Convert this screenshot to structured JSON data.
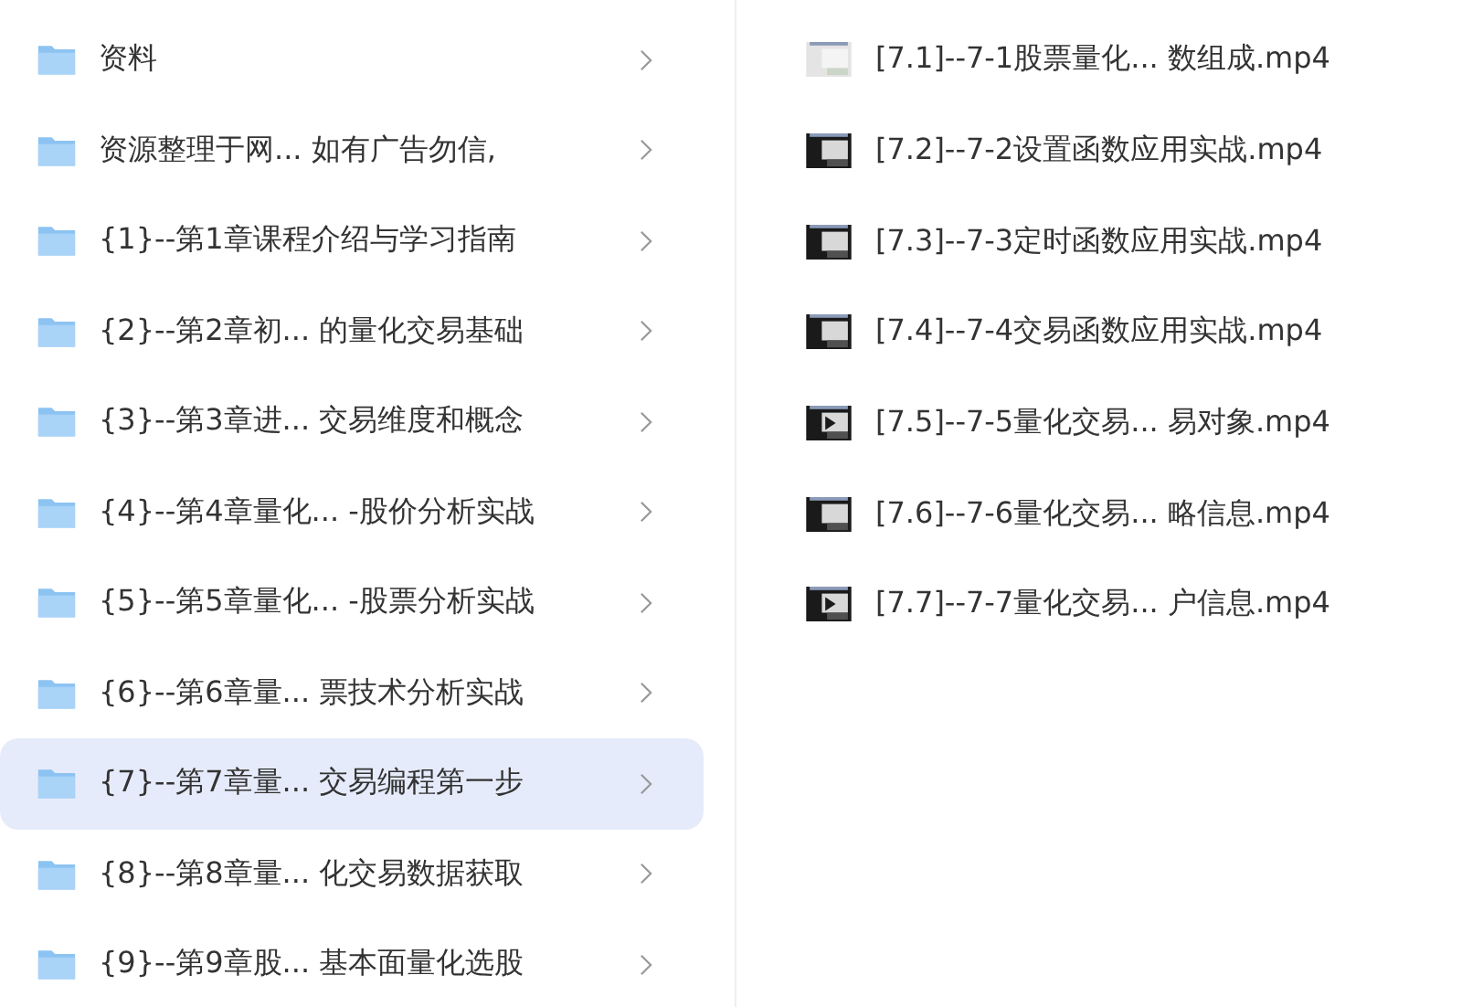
{
  "folders": [
    {
      "name": "资料",
      "selected": false
    },
    {
      "name": "资源整理于网... 如有广告勿信,",
      "selected": false
    },
    {
      "name": "{1}--第1章课程介绍与学习指南",
      "selected": false
    },
    {
      "name": "{2}--第2章初...  的量化交易基础",
      "selected": false
    },
    {
      "name": "{3}--第3章进...  交易维度和概念",
      "selected": false
    },
    {
      "name": "{4}--第4章量化... -股价分析实战",
      "selected": false
    },
    {
      "name": "{5}--第5章量化... -股票分析实战",
      "selected": false
    },
    {
      "name": "{6}--第6章量...  票技术分析实战",
      "selected": false
    },
    {
      "name": "{7}--第7章量...  交易编程第一步",
      "selected": true
    },
    {
      "name": "{8}--第8章量...  化交易数据获取",
      "selected": false
    },
    {
      "name": "{9}--第9章股...  基本面量化选股",
      "selected": false
    }
  ],
  "files": [
    {
      "name": "[7.1]--7-1股票量化...  数组成.mp4"
    },
    {
      "name": "[7.2]--7-2设置函数应用实战.mp4"
    },
    {
      "name": "[7.3]--7-3定时函数应用实战.mp4"
    },
    {
      "name": "[7.4]--7-4交易函数应用实战.mp4"
    },
    {
      "name": "[7.5]--7-5量化交易...  易对象.mp4"
    },
    {
      "name": "[7.6]--7-6量化交易...  略信息.mp4"
    },
    {
      "name": "[7.7]--7-7量化交易...  户信息.mp4"
    }
  ]
}
